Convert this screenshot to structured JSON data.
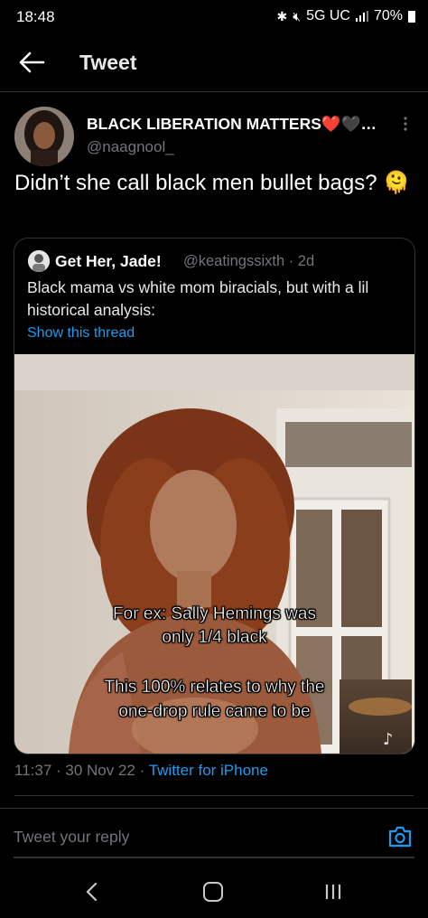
{
  "status_bar": {
    "time": "18:48",
    "network": "5G UC",
    "battery": "70%"
  },
  "header": {
    "title": "Tweet",
    "back_icon": "arrow-left-icon"
  },
  "tweet": {
    "author_name": "BLACK LIBERATION MATTERS❤️🖤…",
    "author_handle": "@naagnool_",
    "text": "Didn’t she call black men bullet bags? 🫠",
    "timestamp": "11:37 · 30 Nov 22 · ",
    "source": "Twitter for iPhone"
  },
  "quoted_tweet": {
    "author_name": "Get Her, Jade!",
    "author_handle": "@keatingssixth · 2d",
    "text": "Black mama vs white mom biracials, but with a lil historical analysis:",
    "link": "Show this thread",
    "video_captions": {
      "line1": "For ex: Sally Hemings was",
      "line2": "only 1/4 black",
      "line3": "This 100% relates to why the",
      "line4": "one-drop rule came to be"
    }
  },
  "reply": {
    "placeholder": "Tweet your reply",
    "camera_icon": "camera-icon"
  },
  "colors": {
    "background": "#000000",
    "link": "#1d9bf0",
    "muted": "#71767b",
    "divider": "#2f3336"
  }
}
